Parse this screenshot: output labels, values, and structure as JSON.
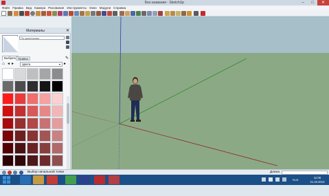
{
  "window": {
    "title": "Без названия - SketchUp",
    "minimize_glyph": "–",
    "maximize_glyph": "□",
    "close_glyph": "✕"
  },
  "menubar": {
    "items": [
      "Файл",
      "Правка",
      "Вид",
      "Камера",
      "Рисование",
      "Инструменты",
      "Окно",
      "Модули",
      "Справка"
    ]
  },
  "panel": {
    "title": "Материалы",
    "close_glyph": "✕",
    "material_name": "По умолчанию",
    "tabs": [
      "Выбрать",
      "Правка"
    ],
    "library": "Цвета",
    "home_glyph": "⌂",
    "back_glyph": "◂",
    "forward_glyph": "▸",
    "detail_glyph": "▸",
    "dropdown_glyph": "▾",
    "eyedrop_glyph": "✎",
    "swatch_colors": [
      [
        "#ffffff",
        "#d9d9d9",
        "#bfbfbf",
        "#a6a6a6",
        "#8c8c8c"
      ],
      [
        "#6b6b6b",
        "#4d4d4d",
        "#2e2e2e",
        "#141414",
        "#000000"
      ],
      [
        "#ff1a1a",
        "#ea3b3b",
        "#f36d6d",
        "#f7a0a0",
        "#fbd0d0"
      ],
      [
        "#d11010",
        "#c23030",
        "#d95858",
        "#e88787",
        "#f2b6b6"
      ],
      [
        "#a80b0b",
        "#993030",
        "#b24848",
        "#c77373",
        "#e39d9d"
      ],
      [
        "#7a0606",
        "#6e1f1f",
        "#8a3333",
        "#a35555",
        "#c98282"
      ],
      [
        "#520303",
        "#4a1313",
        "#6a2424",
        "#8a3f3f",
        "#b06a6a"
      ],
      [
        "#2e0101",
        "#300a0a",
        "#4e1818",
        "#6e2a2a",
        "#8f4f4f"
      ]
    ]
  },
  "statusbar": {
    "text": "Выбор начальной точки",
    "measure_label": "Длина"
  },
  "taskbar": {
    "language": "RUS",
    "time": "11:06",
    "date": "21.10.2013",
    "app_colors": [
      "#2a6fb8",
      "#d8a23a",
      "#d63b2e",
      "#4aa64a",
      "#2f3f8c",
      "#c8282a",
      "#c43c3c"
    ]
  },
  "colors": {
    "sky": "#a6bfc9",
    "ground": "#8ca985",
    "axis_red": "#8a2a2a",
    "axis_green": "#2e8a2e",
    "axis_blue": "#2b3fa0",
    "titlebar": "#ced8e3",
    "taskbar": "#1b4f87"
  }
}
